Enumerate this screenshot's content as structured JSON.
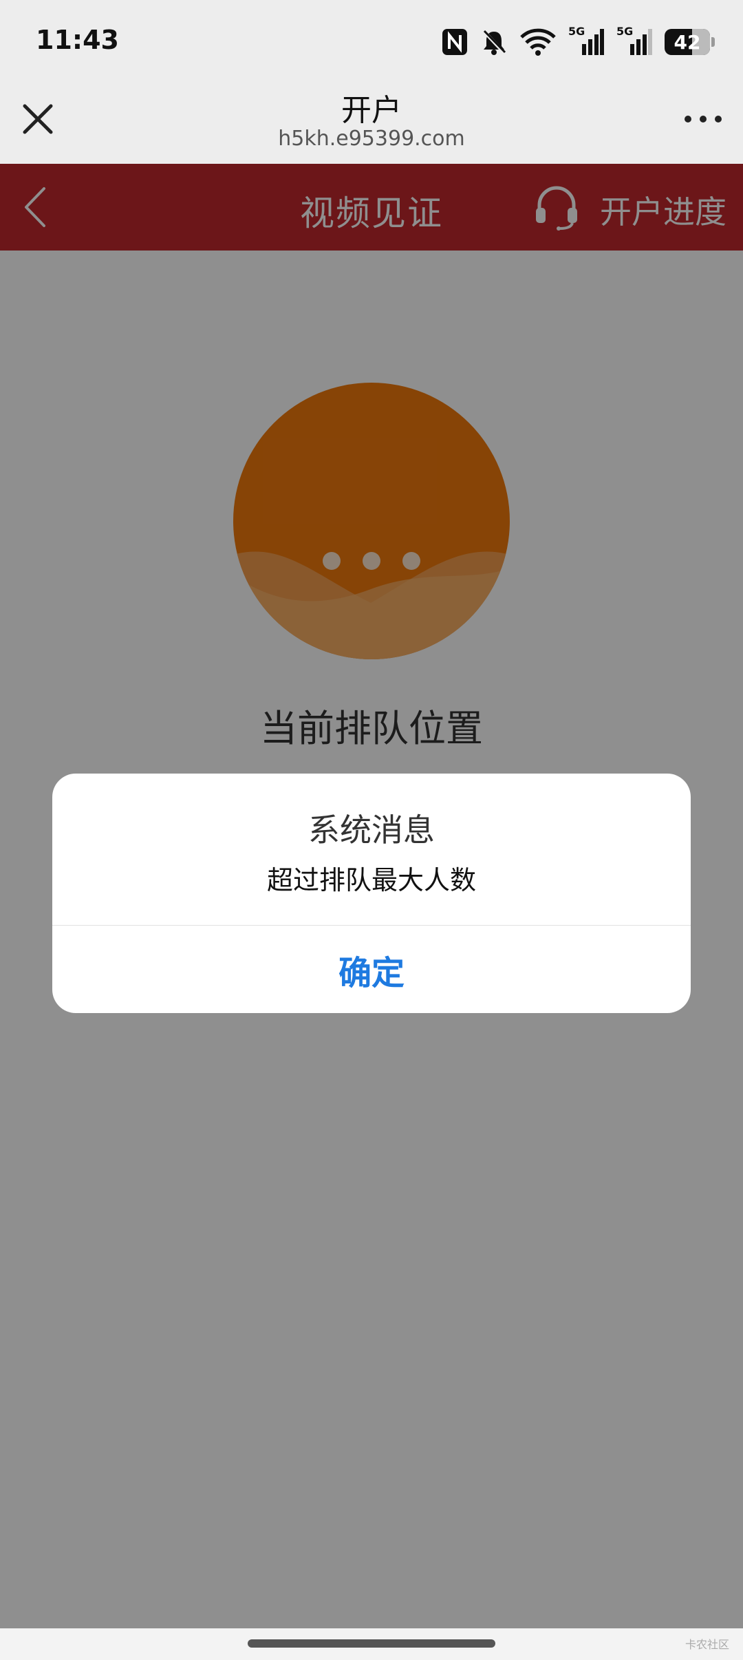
{
  "status_bar": {
    "time": "11:43",
    "battery_level": "42",
    "icons": [
      "nfc-icon",
      "mute-bell-icon",
      "wifi-icon",
      "signal-5g-icon",
      "signal-5g-icon",
      "battery-icon"
    ],
    "signal_label_1": "5G",
    "signal_label_2": "5G"
  },
  "browser": {
    "title": "开户",
    "url": "h5kh.e95399.com"
  },
  "header": {
    "title": "视频见证",
    "progress_link": "开户进度",
    "background_color": "#c0282d"
  },
  "main": {
    "queue_label": "当前排队位置",
    "circle_color": "#f07a0c"
  },
  "dialog": {
    "title": "系统消息",
    "message": "超过排队最大人数",
    "confirm_label": "确定",
    "confirm_color": "#1e7ae0"
  },
  "footer": {
    "watermark": "卡农社区"
  }
}
